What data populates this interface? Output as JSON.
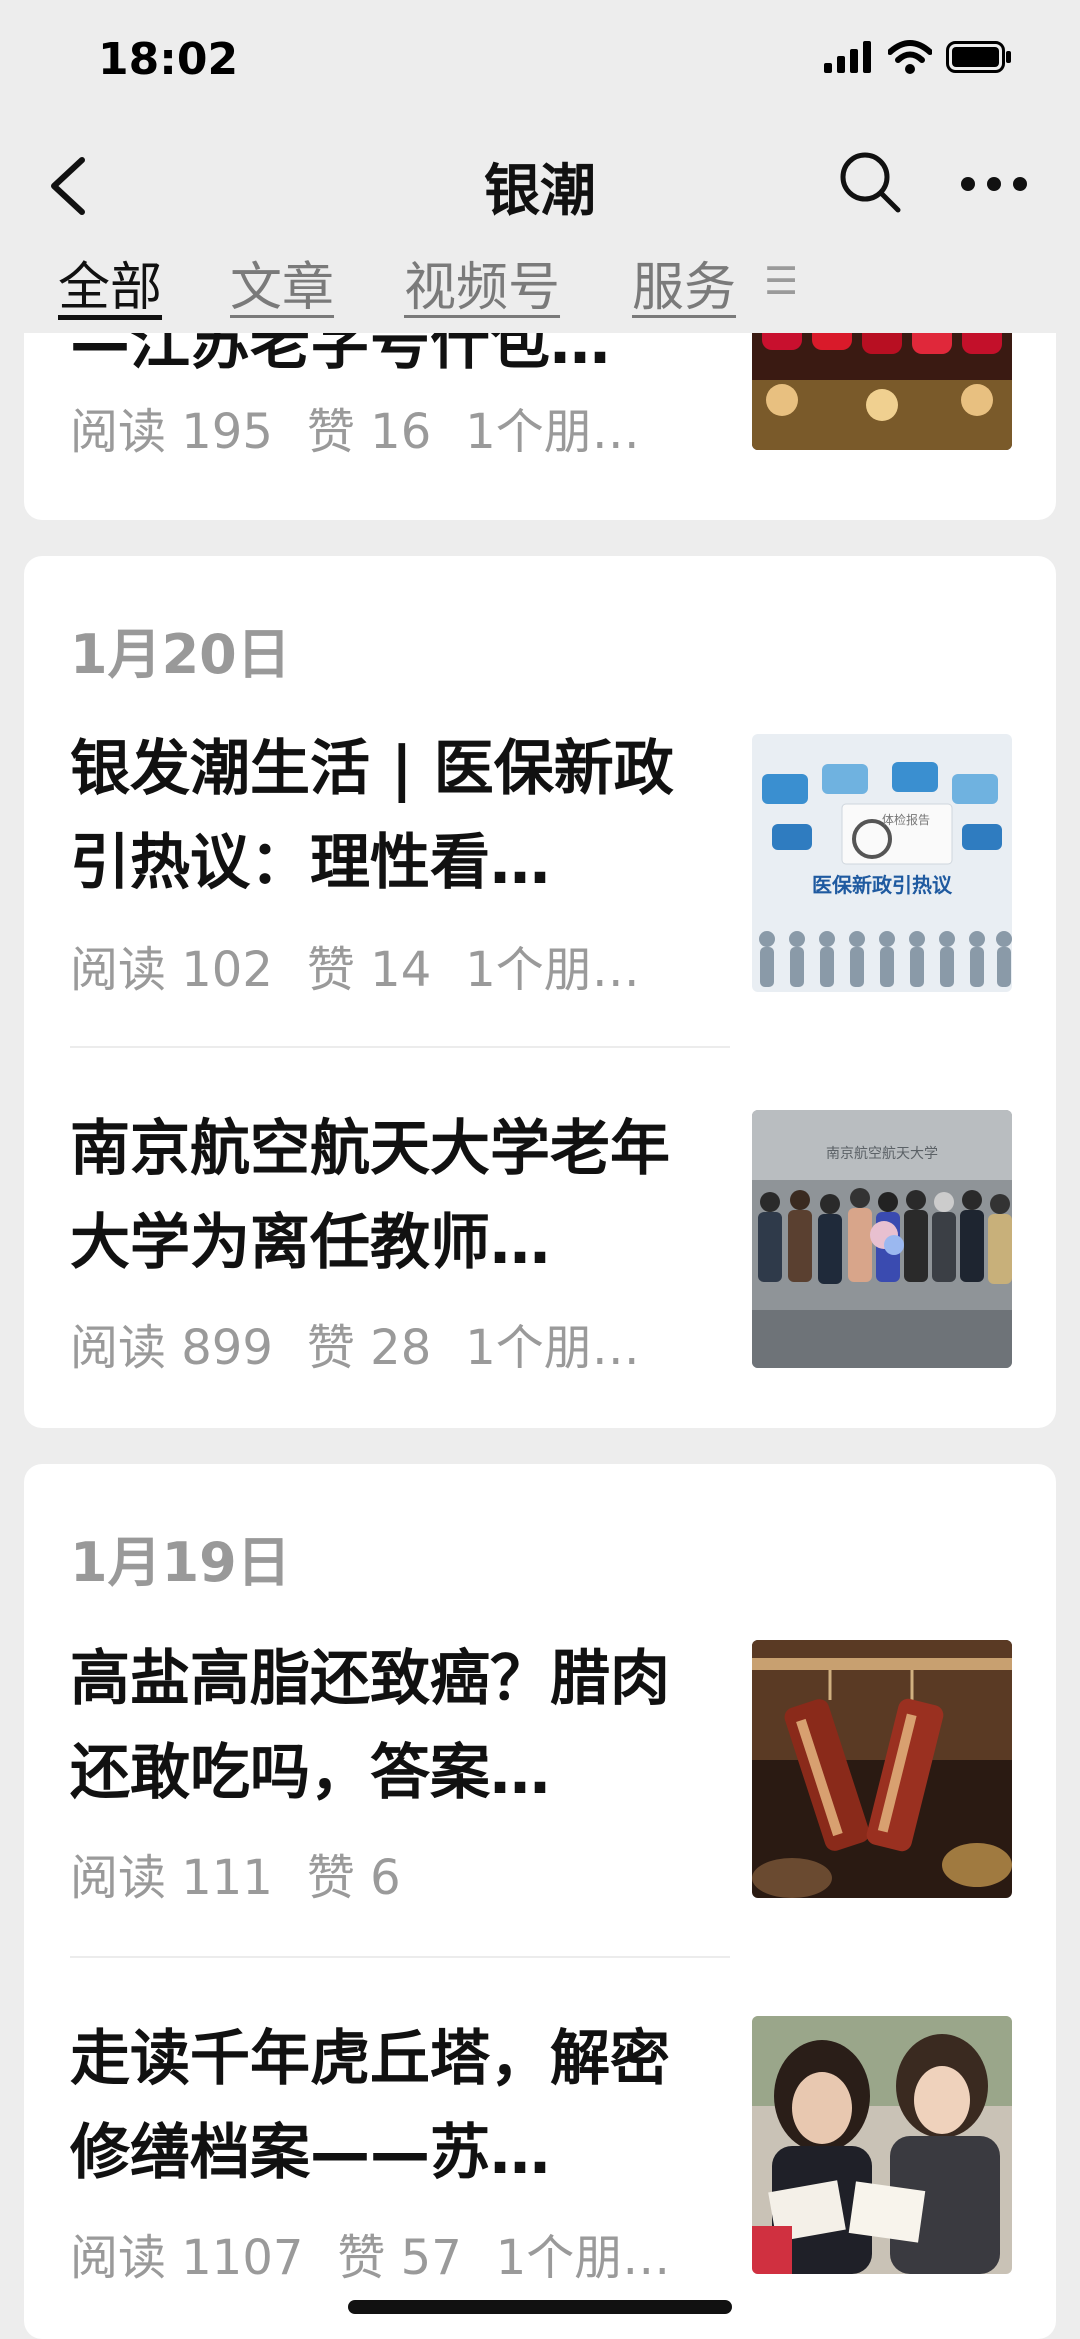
{
  "status": {
    "time": "18:02"
  },
  "nav": {
    "title": "银潮"
  },
  "tabs": [
    {
      "label": "全部",
      "active": true
    },
    {
      "label": "文章",
      "active": false
    },
    {
      "label": "视频号",
      "active": false
    },
    {
      "label": "服务",
      "active": false
    }
  ],
  "tab_menu_glyph": "☰",
  "partial_article": {
    "title_fragment": "—江苏老字号什包…",
    "read": "阅读 195",
    "like": "赞 16",
    "friends": "1个朋…"
  },
  "groups": [
    {
      "date": "1月20日",
      "articles": [
        {
          "title": "银发潮生活 | 医保新政引热议：理性看…",
          "read": "阅读 102",
          "like": "赞 14",
          "friends": "1个朋…",
          "thumb_caption": "医保新政引热议",
          "thumb_sub": "体检报告"
        },
        {
          "title": "南京航空航天大学老年大学为离任教师…",
          "read": "阅读 899",
          "like": "赞 28",
          "friends": "1个朋…",
          "thumb_sign": "南京航空航天大学"
        }
      ]
    },
    {
      "date": "1月19日",
      "articles": [
        {
          "title": "高盐高脂还致癌？腊肉还敢吃吗，答案…",
          "read": "阅读 111",
          "like": "赞 6"
        },
        {
          "title": "走读千年虎丘塔，解密修缮档案——苏…",
          "read": "阅读 1107",
          "like": "赞 57",
          "friends": "1个朋…"
        }
      ]
    }
  ]
}
